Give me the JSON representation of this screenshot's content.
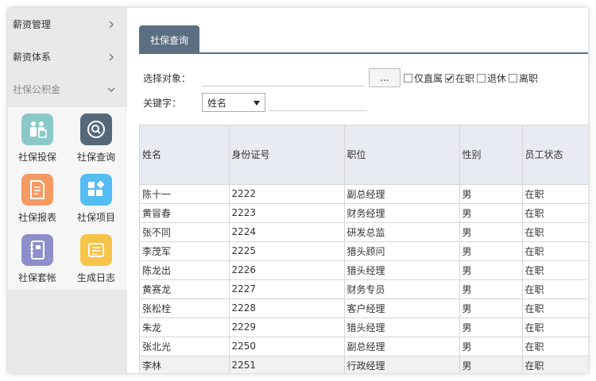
{
  "sidebar": {
    "menu": [
      {
        "label": "薪资管理",
        "state": "collapsed"
      },
      {
        "label": "薪资体系",
        "state": "collapsed"
      },
      {
        "label": "社保公积金",
        "state": "expanded"
      }
    ],
    "tiles": [
      {
        "label": "社保投保",
        "icon": "people-icon",
        "color": "#8bc9c9"
      },
      {
        "label": "社保查询",
        "icon": "search-icon",
        "color": "#55687a"
      },
      {
        "label": "社保报表",
        "icon": "report-icon",
        "color": "#f49a63"
      },
      {
        "label": "社保项目",
        "icon": "grid-icon",
        "color": "#54bdf3"
      },
      {
        "label": "社保套帐",
        "icon": "notebook-icon",
        "color": "#8d8fcc"
      },
      {
        "label": "生成日志",
        "icon": "log-icon",
        "color": "#f7c44a"
      }
    ]
  },
  "main": {
    "tab_label": "社保查询",
    "select_target_label": "选择对象：",
    "dots_label": "...",
    "checkboxes": [
      {
        "label": "仅直属",
        "checked": false
      },
      {
        "label": "在职",
        "checked": true
      },
      {
        "label": "退休",
        "checked": false
      },
      {
        "label": "离职",
        "checked": false
      }
    ],
    "keyword_label": "关键字：",
    "keyword_select_value": "姓名"
  },
  "table": {
    "headers": [
      "姓名",
      "身份证号",
      "职位",
      "性别",
      "员工状态"
    ],
    "rows": [
      [
        "陈十一",
        "2222",
        "副总经理",
        "男",
        "在职"
      ],
      [
        "黄冒春",
        "2223",
        "财务经理",
        "男",
        "在职"
      ],
      [
        "张不同",
        "2224",
        "研发总监",
        "男",
        "在职"
      ],
      [
        "李茂军",
        "2225",
        "猎头顾问",
        "男",
        "在职"
      ],
      [
        "陈龙出",
        "2226",
        "猎头经理",
        "男",
        "在职"
      ],
      [
        "黄赛龙",
        "2227",
        "财务专员",
        "男",
        "在职"
      ],
      [
        "张松栓",
        "2228",
        "客户经理",
        "男",
        "在职"
      ],
      [
        "朱龙",
        "2229",
        "猎头经理",
        "男",
        "在职"
      ],
      [
        "张北光",
        "2250",
        "副总经理",
        "男",
        "在职"
      ],
      [
        "李林",
        "2251",
        "行政经理",
        "男",
        "在职"
      ]
    ]
  }
}
